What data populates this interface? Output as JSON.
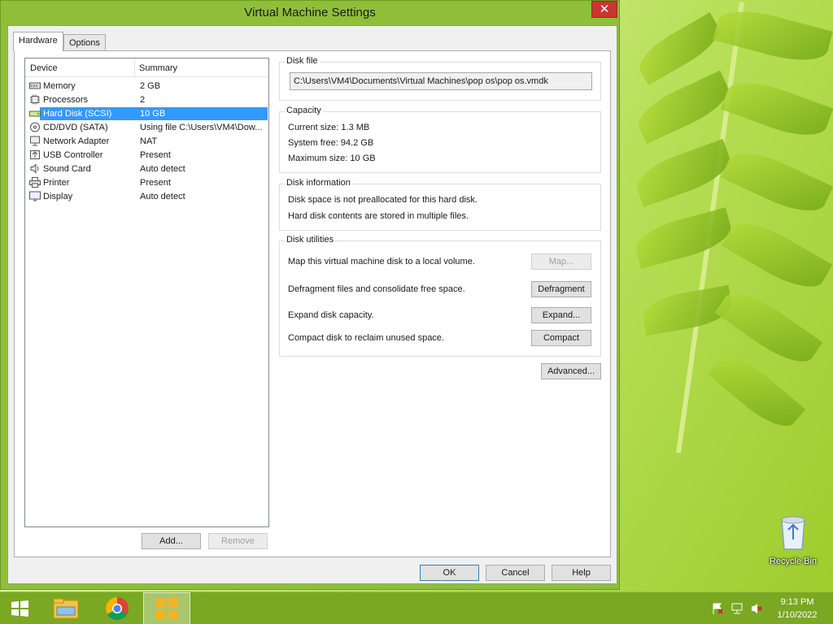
{
  "window": {
    "title": "Virtual Machine Settings",
    "close_glyph": "✕"
  },
  "tabs": [
    {
      "label": "Hardware",
      "active": true
    },
    {
      "label": "Options",
      "active": false
    }
  ],
  "device_list": {
    "header_device": "Device",
    "header_summary": "Summary",
    "rows": [
      {
        "name": "Memory",
        "summary": "2 GB",
        "icon": "memory-icon"
      },
      {
        "name": "Processors",
        "summary": "2",
        "icon": "processor-icon"
      },
      {
        "name": "Hard Disk (SCSI)",
        "summary": "10 GB",
        "icon": "hard-disk-icon",
        "selected": true
      },
      {
        "name": "CD/DVD (SATA)",
        "summary": "Using file C:\\Users\\VM4\\Dow...",
        "icon": "cd-dvd-icon"
      },
      {
        "name": "Network Adapter",
        "summary": "NAT",
        "icon": "network-adapter-icon"
      },
      {
        "name": "USB Controller",
        "summary": "Present",
        "icon": "usb-icon"
      },
      {
        "name": "Sound Card",
        "summary": "Auto detect",
        "icon": "speaker-icon"
      },
      {
        "name": "Printer",
        "summary": "Present",
        "icon": "printer-icon"
      },
      {
        "name": "Display",
        "summary": "Auto detect",
        "icon": "display-icon"
      }
    ],
    "add_label": "Add...",
    "remove_label": "Remove"
  },
  "disk_file": {
    "label": "Disk file",
    "path": "C:\\Users\\VM4\\Documents\\Virtual Machines\\pop os\\pop os.vmdk"
  },
  "capacity": {
    "label": "Capacity",
    "current_size": "Current size:  1.3 MB",
    "system_free": "System free:  94.2 GB",
    "maximum_size": "Maximum size:  10 GB"
  },
  "disk_information": {
    "label": "Disk information",
    "line1": "Disk space is not preallocated for this hard disk.",
    "line2": "Hard disk contents are stored in multiple files."
  },
  "disk_utilities": {
    "label": "Disk utilities",
    "map_text": "Map this virtual machine disk to a local volume.",
    "map_button": "Map...",
    "defrag_text": "Defragment files and consolidate free space.",
    "defrag_button": "Defragment",
    "expand_text": "Expand disk capacity.",
    "expand_button": "Expand...",
    "compact_text": "Compact disk to reclaim unused space.",
    "compact_button": "Compact"
  },
  "advanced_button": "Advanced...",
  "footer": {
    "ok": "OK",
    "cancel": "Cancel",
    "help": "Help"
  },
  "desktop": {
    "recycle_bin": "Recycle Bin"
  },
  "taskbar": {
    "time": "9:13 PM",
    "date": "1/10/2022",
    "items": [
      "windows-start-icon",
      "file-explorer-icon",
      "chrome-icon",
      "vmware-icon"
    ]
  }
}
